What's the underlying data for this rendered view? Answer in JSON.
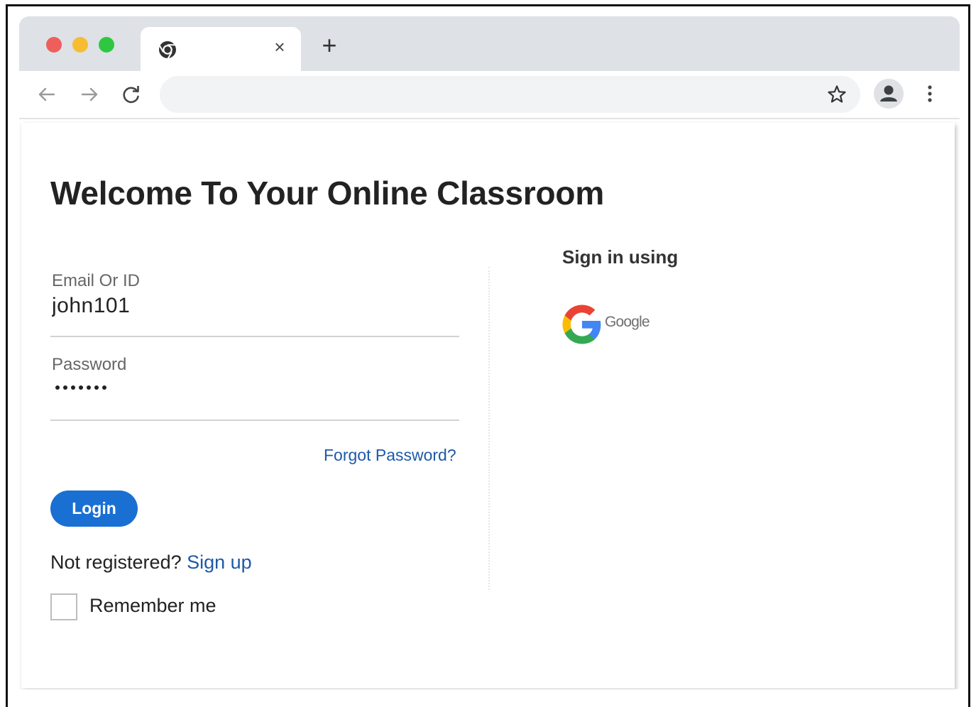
{
  "browser": {
    "tab": {
      "title": "",
      "close_symbol": "×"
    },
    "new_tab_symbol": "+",
    "address_bar": {
      "value": ""
    },
    "icons": [
      "chrome-icon",
      "back-arrow-icon",
      "forward-arrow-icon",
      "reload-icon",
      "star-icon",
      "profile-icon",
      "kebab-menu-icon"
    ]
  },
  "page": {
    "title": "Welcome To Your Online Classroom",
    "form": {
      "email_label": "Email Or ID",
      "email_value": "john101",
      "password_label": "Password",
      "password_masked": "•••••••",
      "forgot_password": "Forgot Password?",
      "login_button": "Login",
      "not_registered": "Not registered?",
      "sign_up": "Sign up",
      "remember_me": "Remember me",
      "remember_checked": false
    },
    "social": {
      "heading": "Sign in using",
      "google_label": "Google"
    }
  },
  "colors": {
    "primary_button": "#1a6fd3",
    "link": "#1e5aa8",
    "tab_strip": "#dee1e6",
    "traffic_red": "#ee5f5b",
    "traffic_yellow": "#f7bd32",
    "traffic_green": "#2fc741"
  }
}
